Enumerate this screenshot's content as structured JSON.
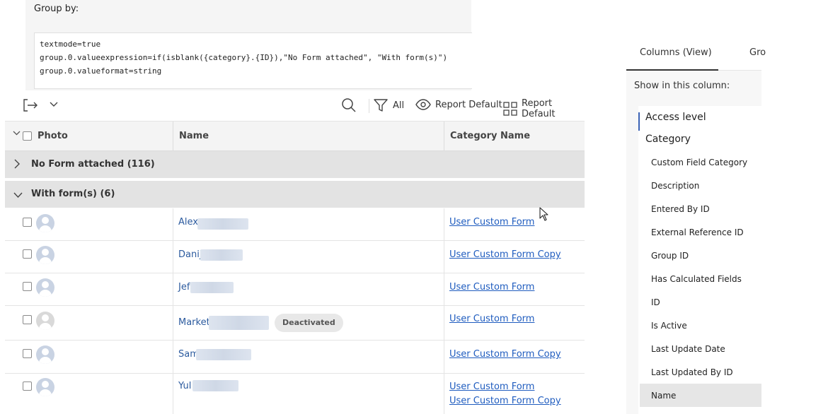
{
  "groupby": {
    "label": "Group by:",
    "code_lines": [
      "textmode=true",
      "group.0.valueexpression=if(isblank({category}.{ID}),\"No Form attached\", \"With form(s)\")",
      "group.0.valueformat=string"
    ]
  },
  "toolbar": {
    "filter_label": "All",
    "view_label": "Report Default",
    "grouping_label": "Report Default",
    "icons": [
      "export-icon",
      "chevron-down-icon",
      "search-icon",
      "filter-icon",
      "eye-icon",
      "grid-icon"
    ]
  },
  "columns": {
    "photo": "Photo",
    "name": "Name",
    "category": "Category Name"
  },
  "groups": [
    {
      "label": "No Form attached (116)",
      "expanded": false
    },
    {
      "label": "With form(s) (6)",
      "expanded": true
    }
  ],
  "rows": [
    {
      "name": "Alex",
      "forms": [
        "User Custom Form"
      ],
      "badge": ""
    },
    {
      "name": "Danij",
      "forms": [
        "User Custom Form Copy"
      ],
      "badge": ""
    },
    {
      "name": "Jef",
      "forms": [
        "User Custom Form"
      ],
      "badge": ""
    },
    {
      "name": "Marketi",
      "forms": [
        "User Custom Form"
      ],
      "badge": "Deactivated"
    },
    {
      "name": "Sam",
      "forms": [
        "User Custom Form Copy"
      ],
      "badge": ""
    },
    {
      "name": "Yul",
      "forms": [
        "User Custom Form",
        "User Custom Form Copy"
      ],
      "badge": ""
    }
  ],
  "right_panel": {
    "tab_columns": "Columns (View)",
    "tab_groupings": "Gro",
    "section_title": "Show in this column:",
    "categories": [
      "Access level",
      "Category"
    ],
    "fields": [
      "Custom Field Category",
      "Description",
      "Entered By ID",
      "External Reference ID",
      "Group ID",
      "Has Calculated Fields",
      "ID",
      "Is Active",
      "Last Update Date",
      "Last Updated By ID",
      "Name"
    ],
    "selected_field": "Name"
  },
  "colors": {
    "link": "#1f5cbf",
    "name_link": "#2b5a9e",
    "group_bg": "#e3e3e3",
    "accent": "#3b63b5"
  }
}
